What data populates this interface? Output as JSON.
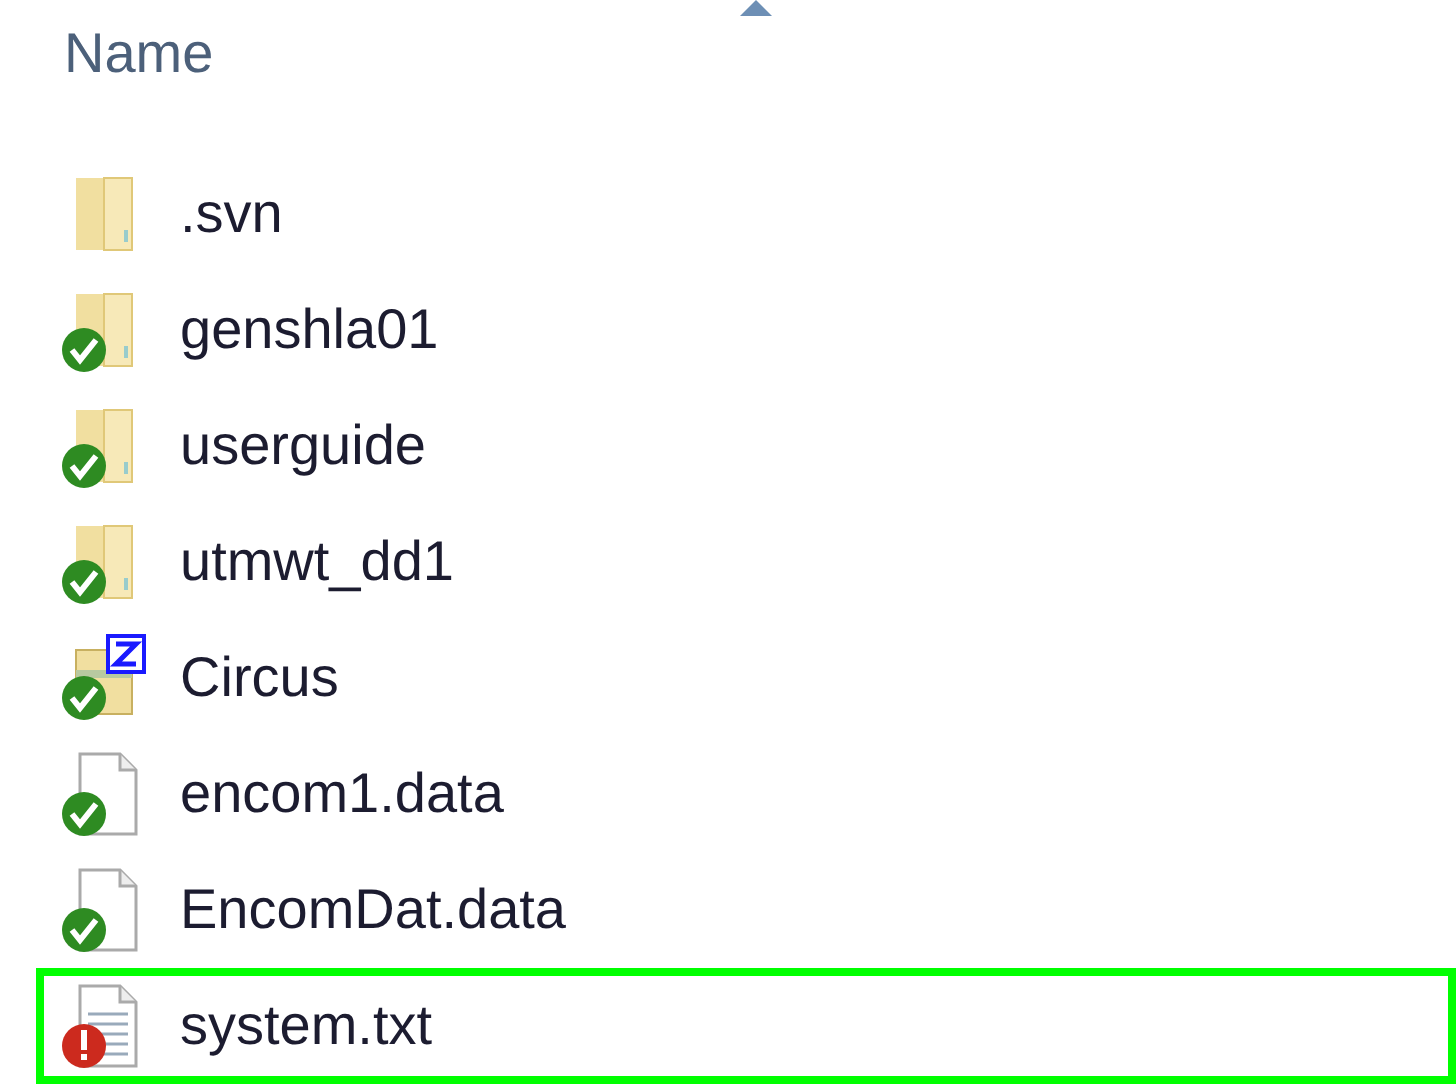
{
  "column_header": {
    "label": "Name",
    "sorted": true
  },
  "files": [
    {
      "name": ".svn",
      "kind": "folder",
      "up_to_date": false,
      "conflicted": false,
      "highlighted": false
    },
    {
      "name": "genshla01",
      "kind": "folder",
      "up_to_date": true,
      "conflicted": false,
      "highlighted": false
    },
    {
      "name": "userguide",
      "kind": "folder",
      "up_to_date": true,
      "conflicted": false,
      "highlighted": false
    },
    {
      "name": "utmwt_dd1",
      "kind": "folder",
      "up_to_date": true,
      "conflicted": false,
      "highlighted": false
    },
    {
      "name": "Circus",
      "kind": "archive",
      "up_to_date": true,
      "conflicted": false,
      "highlighted": false
    },
    {
      "name": "encom1.data",
      "kind": "file",
      "up_to_date": true,
      "conflicted": false,
      "highlighted": false
    },
    {
      "name": "EncomDat.data",
      "kind": "file",
      "up_to_date": true,
      "conflicted": false,
      "highlighted": false
    },
    {
      "name": "system.txt",
      "kind": "text",
      "up_to_date": false,
      "conflicted": true,
      "highlighted": true
    }
  ]
}
